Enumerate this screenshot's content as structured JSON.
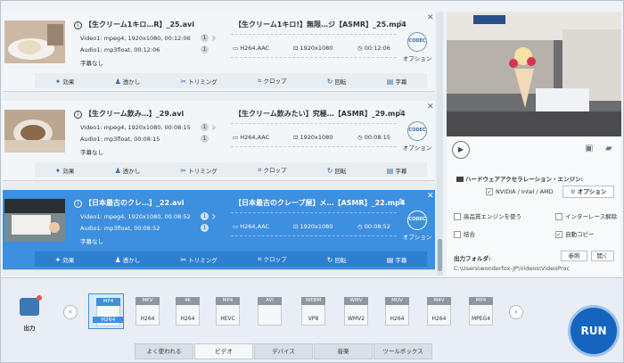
{
  "files": [
    {
      "input_name": "【生クリーム1キロ…R】_25.avi",
      "video": "Video1: mpeg4, 1920x1080, 00:12:06",
      "video_count": "1",
      "audio": "Audio1: mp3float, 00:12:06",
      "audio_count": "1",
      "subtitle": "字幕なし",
      "output_name": "【生クリーム1キロ!】無限…ジ【ASMR】_25.mp4",
      "codec": "H264,AAC",
      "resolution": "1920x1080",
      "duration": "00:12:06"
    },
    {
      "input_name": "【生クリーム飲み…】_29.avi",
      "video": "Video1: mpeg4, 1920x1080, 00:08:15",
      "video_count": "1",
      "audio": "Audio1: mp3float, 00:08:15",
      "audio_count": "1",
      "subtitle": "字幕なし",
      "output_name": "【生クリーム飲みたい】究極…【ASMR】_29.mp4",
      "codec": "H264,AAC",
      "resolution": "1920x1080",
      "duration": "00:08:15"
    },
    {
      "input_name": "【日本最古のクレ…】_22.avi",
      "video": "Video1: mpeg4, 1920x1080, 00:08:52",
      "video_count": "1",
      "audio": "Audio1: mp3float, 00:08:52",
      "audio_count": "1",
      "subtitle": "字幕なし",
      "output_name": "【日本最古のクレープ屋】メ…【ASMR】_22.mp4",
      "codec": "H264,AAC",
      "resolution": "1920x1080",
      "duration": "00:08:52"
    }
  ],
  "edit_tools": {
    "effect": "効果",
    "watermark": "透かし",
    "trim": "トリミング",
    "crop": "クロップ",
    "rotate": "回転",
    "subtitle": "字幕"
  },
  "option_label": "オプション",
  "codec_icon_text": "CODEC",
  "hw": {
    "title": "ハードウェアアクセラレーション・エンジン:",
    "nvidia": "NVIDIA / Intel / AMD",
    "option_button": "オプション",
    "high_quality": "高品質エンジンを使う",
    "deinterlace": "インターレース解除",
    "merge": "結合",
    "auto_copy": "自動コピー",
    "output_folder": "出力フォルダ:",
    "browse": "参照",
    "open": "開く",
    "path": "C:\\Users\\wonderfox-JP\\Videos\\VideoProc"
  },
  "output_label": "出力",
  "formats": [
    {
      "tag": "MP4",
      "sub": "H264"
    },
    {
      "tag": "MKV",
      "sub": "H264"
    },
    {
      "tag": "4K",
      "sub": "H264"
    },
    {
      "tag": "MP4",
      "sub": "HEVC"
    },
    {
      "tag": "AVI",
      "sub": ""
    },
    {
      "tag": "WEBM",
      "sub": "VP8"
    },
    {
      "tag": "WMV",
      "sub": "WMV2"
    },
    {
      "tag": "MOV",
      "sub": "H264"
    },
    {
      "tag": "M4V",
      "sub": "H264"
    },
    {
      "tag": "MP4",
      "sub": "MPEG4"
    }
  ],
  "tabs": [
    "よく使われる",
    "ビデオ",
    "デバイス",
    "音楽",
    "ツールボックス"
  ],
  "run_label": "RUN"
}
